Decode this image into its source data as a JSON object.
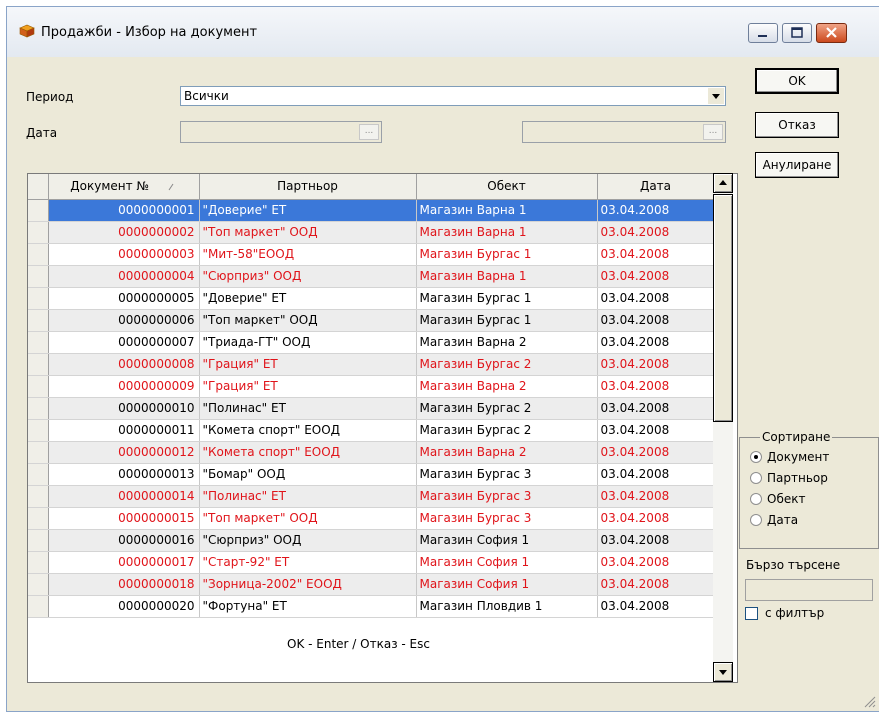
{
  "window": {
    "title": "Продажби - Избор на документ",
    "icon": "cube-icon"
  },
  "filters": {
    "period_label": "Период",
    "period_value": "Всички",
    "date_label": "Дата",
    "date_button": "..."
  },
  "buttons": {
    "ok": "OK",
    "cancel": "Отказ",
    "void": "Анулиране"
  },
  "table": {
    "columns": [
      "Документ №",
      "Партньор",
      "Обект",
      "Дата"
    ],
    "rows": [
      {
        "doc": "0000000001",
        "partner": "\"Доверие\" ЕТ",
        "site": "Магазин Варна 1",
        "date": "03.04.2008",
        "red": false,
        "selected": true
      },
      {
        "doc": "0000000002",
        "partner": "\"Топ маркет\" ООД",
        "site": "Магазин Варна 1",
        "date": "03.04.2008",
        "red": true,
        "selected": false
      },
      {
        "doc": "0000000003",
        "partner": "\"Мит-58\"ЕООД",
        "site": "Магазин Бургас 1",
        "date": "03.04.2008",
        "red": true,
        "selected": false
      },
      {
        "doc": "0000000004",
        "partner": "\"Сюрприз\" ООД",
        "site": "Магазин Варна 1",
        "date": "03.04.2008",
        "red": true,
        "selected": false
      },
      {
        "doc": "0000000005",
        "partner": "\"Доверие\" ЕТ",
        "site": "Магазин Бургас 1",
        "date": "03.04.2008",
        "red": false,
        "selected": false
      },
      {
        "doc": "0000000006",
        "partner": "\"Топ маркет\" ООД",
        "site": "Магазин Бургас 1",
        "date": "03.04.2008",
        "red": false,
        "selected": false
      },
      {
        "doc": "0000000007",
        "partner": "\"Триада-ГТ\" ООД",
        "site": "Магазин Варна 2",
        "date": "03.04.2008",
        "red": false,
        "selected": false
      },
      {
        "doc": "0000000008",
        "partner": "\"Грация\" ЕТ",
        "site": "Магазин Бургас 2",
        "date": "03.04.2008",
        "red": true,
        "selected": false
      },
      {
        "doc": "0000000009",
        "partner": "\"Грация\" ЕТ",
        "site": "Магазин Варна 2",
        "date": "03.04.2008",
        "red": true,
        "selected": false
      },
      {
        "doc": "0000000010",
        "partner": "\"Полинас\" ЕТ",
        "site": "Магазин Бургас 2",
        "date": "03.04.2008",
        "red": false,
        "selected": false
      },
      {
        "doc": "0000000011",
        "partner": "\"Комета спорт\" ЕООД",
        "site": "Магазин Бургас 2",
        "date": "03.04.2008",
        "red": false,
        "selected": false
      },
      {
        "doc": "0000000012",
        "partner": "\"Комета спорт\" ЕООД",
        "site": "Магазин Варна 2",
        "date": "03.04.2008",
        "red": true,
        "selected": false
      },
      {
        "doc": "0000000013",
        "partner": "\"Бомар\" ООД",
        "site": "Магазин Бургас 3",
        "date": "03.04.2008",
        "red": false,
        "selected": false
      },
      {
        "doc": "0000000014",
        "partner": "\"Полинас\" ЕТ",
        "site": "Магазин Бургас 3",
        "date": "03.04.2008",
        "red": true,
        "selected": false
      },
      {
        "doc": "0000000015",
        "partner": "\"Топ маркет\" ООД",
        "site": "Магазин Бургас 3",
        "date": "03.04.2008",
        "red": true,
        "selected": false
      },
      {
        "doc": "0000000016",
        "partner": "\"Сюрприз\" ООД",
        "site": "Магазин София 1",
        "date": "03.04.2008",
        "red": false,
        "selected": false
      },
      {
        "doc": "0000000017",
        "partner": "\"Старт-92\" ЕТ",
        "site": "Магазин София 1",
        "date": "03.04.2008",
        "red": true,
        "selected": false
      },
      {
        "doc": "0000000018",
        "partner": "\"Зорница-2002\" ЕООД",
        "site": "Магазин София 1",
        "date": "03.04.2008",
        "red": true,
        "selected": false
      },
      {
        "doc": "0000000020",
        "partner": "\"Фортуна\" ЕТ",
        "site": "Магазин Пловдив 1",
        "date": "03.04.2008",
        "red": false,
        "selected": false
      }
    ]
  },
  "sort": {
    "title": "Сортиране",
    "options": [
      "Документ",
      "Партньор",
      "Обект",
      "Дата"
    ],
    "selected": 0
  },
  "quick_search": {
    "label": "Бързо търсене",
    "value": "",
    "filter_label": "с филтър",
    "filter_checked": false
  },
  "status_text": "OK - Enter / Отказ - Esc",
  "colors": {
    "selection": "#3b78d9",
    "red_text": "#e0141a",
    "alt_row": "#ededed"
  }
}
